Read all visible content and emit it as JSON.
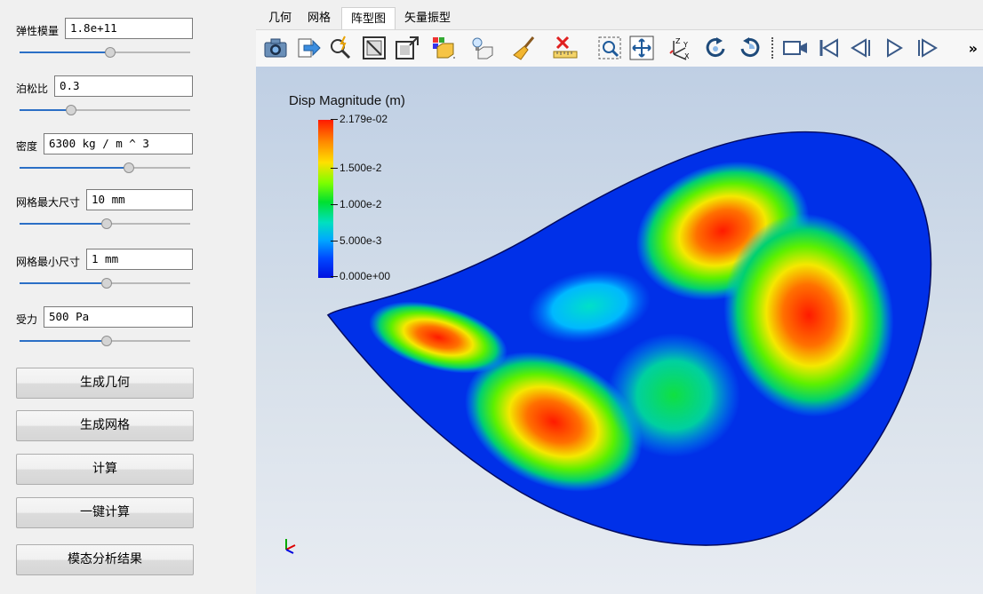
{
  "params": [
    {
      "label": "弹性模量",
      "value": "1.8e+11",
      "slider": 0.53
    },
    {
      "label": "泊松比",
      "value": "0.3",
      "slider": 0.3
    },
    {
      "label": "密度",
      "value": "6300 kg / m ^ 3",
      "slider": 0.64
    },
    {
      "label": "网格最大尺寸",
      "value": "10 mm",
      "slider": 0.51
    },
    {
      "label": "网格最小尺寸",
      "value": "1 mm",
      "slider": 0.51
    },
    {
      "label": "受力",
      "value": "500 Pa",
      "slider": 0.51
    }
  ],
  "buttons": [
    "生成几何",
    "生成网格",
    "计算",
    "一键计算",
    "模态分析结果"
  ],
  "tabs": [
    "几何",
    "网格",
    "阵型图",
    "矢量振型"
  ],
  "active_tab": "阵型图",
  "toolbar_icons": [
    "camera-icon",
    "export-icon",
    "probe-icon",
    "frame-icon",
    "resize-icon",
    "color-box-icon",
    "light-bulb-icon",
    "broom-icon",
    "delete-measure-icon",
    "zoom-box-icon",
    "fit-view-icon",
    "axes-icon",
    "rotate-cw-icon",
    "rotate-ccw-icon",
    "video-camera-icon",
    "first-frame-icon",
    "prev-frame-icon",
    "play-icon",
    "next-frame-icon"
  ],
  "toolbar_more": "»",
  "legend": {
    "title": "Disp Magnitude (m)",
    "ticks": [
      "2.179e-02",
      "1.500e-2",
      "1.000e-2",
      "5.000e-3",
      "0.000e+00"
    ]
  },
  "colors": {
    "accent": "#2b6fc6",
    "max": "#ff1a00",
    "min": "#0010e0"
  }
}
